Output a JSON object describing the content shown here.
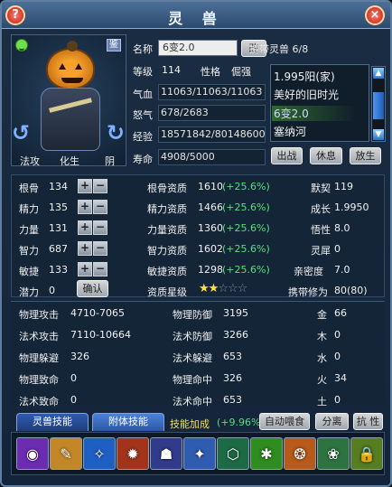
{
  "window": {
    "title": "灵 兽",
    "help_icon": "?",
    "close_icon": "×"
  },
  "portrait": {
    "smile_icon": "😊",
    "seal_label": "鉴",
    "tags": [
      "法攻",
      "化生",
      "阴"
    ]
  },
  "info": {
    "name_label": "名称",
    "name_value": "6变2.0",
    "rename_label": "改",
    "level_label": "等级",
    "level_value": "114",
    "nature_label": "性格",
    "nature_value": "倔强",
    "hp_label": "气血",
    "hp_value": "11063/11063/11063",
    "anger_label": "怒气",
    "anger_value": "678/2683",
    "exp_label": "经验",
    "exp_value": "18571842/80148600",
    "life_label": "寿命",
    "life_value": "4908/5000"
  },
  "carry": {
    "title": "携带灵兽",
    "count": "6/8",
    "pets": [
      "1.995阳(家)",
      "美好的旧时光",
      "6变2.0",
      "塞纳河"
    ],
    "buttons": [
      "出战",
      "休息",
      "放生"
    ]
  },
  "stats": {
    "left": [
      {
        "label": "根骨",
        "value": "134"
      },
      {
        "label": "精力",
        "value": "135"
      },
      {
        "label": "力量",
        "value": "131"
      },
      {
        "label": "智力",
        "value": "687"
      },
      {
        "label": "敏捷",
        "value": "133"
      },
      {
        "label": "潜力",
        "value": "0"
      }
    ],
    "confirm_label": "确认",
    "mid": [
      {
        "label": "根骨资质",
        "value": "1610",
        "bonus": "(+25.6%)"
      },
      {
        "label": "精力资质",
        "value": "1466",
        "bonus": "(+25.6%)"
      },
      {
        "label": "力量资质",
        "value": "1360",
        "bonus": "(+25.6%)"
      },
      {
        "label": "智力资质",
        "value": "1602",
        "bonus": "(+25.6%)"
      },
      {
        "label": "敏捷资质",
        "value": "1298",
        "bonus": "(+25.6%)"
      }
    ],
    "star_label": "资质星级",
    "star_value": 2,
    "star_max": 5,
    "right": [
      {
        "label": "默契",
        "value": "119"
      },
      {
        "label": "成长",
        "value": "1.9950"
      },
      {
        "label": "悟性",
        "value": "8.0"
      },
      {
        "label": "灵犀",
        "value": "0"
      },
      {
        "label": "亲密度",
        "value": "7.0"
      },
      {
        "label": "携带修为",
        "value": "80(80)"
      }
    ]
  },
  "battle": {
    "left": [
      {
        "label": "物理攻击",
        "value": "4710-7065"
      },
      {
        "label": "法术攻击",
        "value": "7110-10664"
      },
      {
        "label": "物理躲避",
        "value": "326"
      },
      {
        "label": "物理致命",
        "value": "0"
      },
      {
        "label": "法术致命",
        "value": "0"
      }
    ],
    "mid": [
      {
        "label": "物理防御",
        "value": "3195"
      },
      {
        "label": "法术防御",
        "value": "3266"
      },
      {
        "label": "法术躲避",
        "value": "653"
      },
      {
        "label": "物理命中",
        "value": "326"
      },
      {
        "label": "法术命中",
        "value": "653"
      }
    ],
    "right": [
      {
        "label": "金",
        "value": "66"
      },
      {
        "label": "木",
        "value": "0"
      },
      {
        "label": "水",
        "value": "0"
      },
      {
        "label": "火",
        "value": "34"
      },
      {
        "label": "土",
        "value": "0"
      }
    ]
  },
  "tabs": {
    "items": [
      "灵兽技能",
      "附体技能"
    ],
    "bonus_label": "技能加成",
    "bonus_value": "(+9.96%)",
    "buttons": [
      "自动喂食",
      "分离",
      "抗 性"
    ]
  },
  "skills": [
    {
      "name": "skill-1",
      "icon": "shadow-orb-icon",
      "color": "#6c2cb2",
      "glyph": "◉"
    },
    {
      "name": "skill-2",
      "icon": "feather-icon",
      "color": "#c48727",
      "glyph": "✎"
    },
    {
      "name": "skill-3",
      "icon": "ice-shard-icon",
      "color": "#1e5fc4",
      "glyph": "✧"
    },
    {
      "name": "skill-4",
      "icon": "fire-burst-icon",
      "color": "#a1341b",
      "glyph": "✹"
    },
    {
      "name": "skill-5",
      "icon": "ghost-icon",
      "color": "#303c8a",
      "glyph": "☗"
    },
    {
      "name": "skill-6",
      "icon": "lightning-icon",
      "color": "#2f5bb1",
      "glyph": "✦"
    },
    {
      "name": "skill-7",
      "icon": "green-shield-icon",
      "color": "#1c6b46",
      "glyph": "⬡"
    },
    {
      "name": "skill-8",
      "icon": "green-aura-icon",
      "color": "#2f8c1f",
      "glyph": "✱"
    },
    {
      "name": "skill-9",
      "icon": "claw-icon",
      "color": "#b85a1a",
      "glyph": "❂"
    },
    {
      "name": "skill-10",
      "icon": "lotus-icon",
      "color": "#2d7341",
      "glyph": "❀"
    },
    {
      "name": "skill-11",
      "icon": "lock-icon",
      "color": "#567d1f",
      "glyph": "🔒"
    }
  ]
}
